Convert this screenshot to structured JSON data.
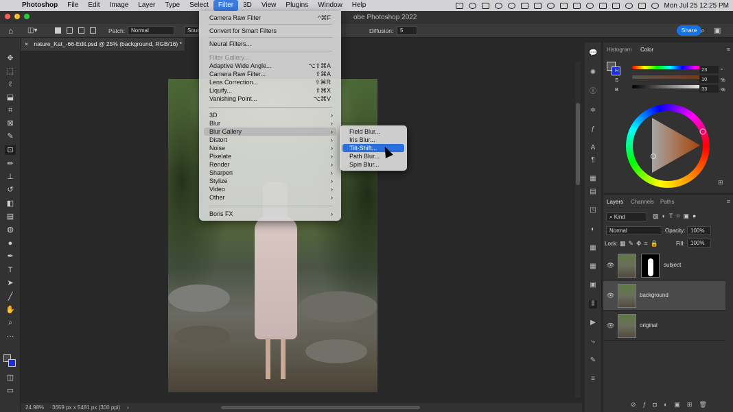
{
  "menubar": {
    "items": [
      "Photoshop",
      "File",
      "Edit",
      "Image",
      "Layer",
      "Type",
      "Select",
      "Filter",
      "3D",
      "View",
      "Plugins",
      "Window",
      "Help"
    ],
    "active": "Filter",
    "clock": "Mon Jul 25  12:25 PM"
  },
  "window": {
    "title_suffix": "obe Photoshop 2022"
  },
  "options": {
    "patch_label": "Patch:",
    "patch_mode": "Normal",
    "source_label": "Sour",
    "diffusion_label": "Diffusion:",
    "diffusion_value": "5",
    "share_label": "Share"
  },
  "document": {
    "tab": "nature_Kat_-66-Edit.psd @ 25% (background, RGB/16) *",
    "zoom": "24.98%",
    "size_info": "3659 px x 5481 px (300 ppi)"
  },
  "filter_menu": {
    "group1": [
      {
        "label": "Camera Raw Filter",
        "shortcut": "^⌘F"
      }
    ],
    "group2": [
      {
        "label": "Convert for Smart Filters"
      }
    ],
    "group3": [
      {
        "label": "Neural Filters..."
      }
    ],
    "group4": [
      {
        "label": "Filter Gallery...",
        "disabled": true
      },
      {
        "label": "Adaptive Wide Angle...",
        "shortcut": "⌥⇧⌘A"
      },
      {
        "label": "Camera Raw Filter...",
        "shortcut": "⇧⌘A"
      },
      {
        "label": "Lens Correction...",
        "shortcut": "⇧⌘R"
      },
      {
        "label": "Liquify...",
        "shortcut": "⇧⌘X"
      },
      {
        "label": "Vanishing Point...",
        "shortcut": "⌥⌘V"
      }
    ],
    "group5": [
      {
        "label": "3D"
      },
      {
        "label": "Blur"
      },
      {
        "label": "Blur Gallery",
        "highlighted": true
      },
      {
        "label": "Distort"
      },
      {
        "label": "Noise"
      },
      {
        "label": "Pixelate"
      },
      {
        "label": "Render"
      },
      {
        "label": "Sharpen"
      },
      {
        "label": "Stylize"
      },
      {
        "label": "Video"
      },
      {
        "label": "Other"
      }
    ],
    "group6": [
      {
        "label": "Boris FX"
      }
    ]
  },
  "blur_gallery_submenu": {
    "items": [
      "Field Blur...",
      "Iris Blur...",
      "Tilt-Shift...",
      "Path Blur...",
      "Spin Blur..."
    ],
    "selected": "Tilt-Shift..."
  },
  "color_panel": {
    "tabs": [
      "Histogram",
      "Color"
    ],
    "active": "Color",
    "h": {
      "label": "H",
      "value": "23",
      "unit": "°"
    },
    "s": {
      "label": "S",
      "value": "10",
      "unit": "%"
    },
    "b": {
      "label": "B",
      "value": "33",
      "unit": "%"
    }
  },
  "layers_panel": {
    "tabs": [
      "Layers",
      "Channels",
      "Paths"
    ],
    "active": "Layers",
    "filter_kind": "Kind",
    "blend_mode": "Normal",
    "opacity_label": "Opacity:",
    "opacity": "100%",
    "lock_label": "Lock:",
    "fill_label": "Fill:",
    "fill": "100%",
    "layers": [
      {
        "name": "subject",
        "has_mask": true
      },
      {
        "name": "background",
        "selected": true
      },
      {
        "name": "original"
      }
    ]
  }
}
